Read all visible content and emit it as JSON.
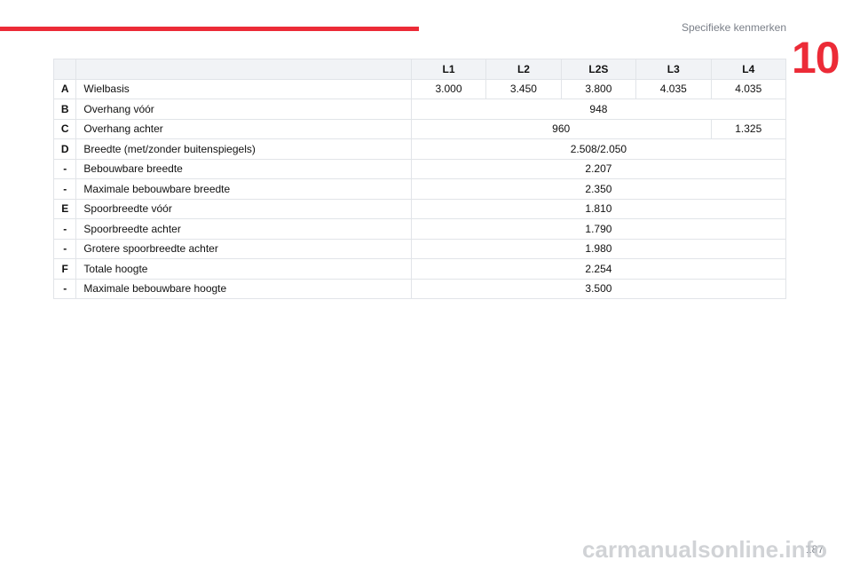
{
  "header": {
    "section_title": "Specifieke kenmerken",
    "chapter_number": "10",
    "accent_color": "#ec2b37"
  },
  "table": {
    "columns": [
      "L1",
      "L2",
      "L2S",
      "L3",
      "L4"
    ],
    "rows": [
      {
        "letter": "A",
        "label": "Wielbasis",
        "values": [
          {
            "text": "3.000",
            "span": 1
          },
          {
            "text": "3.450",
            "span": 1
          },
          {
            "text": "3.800",
            "span": 1
          },
          {
            "text": "4.035",
            "span": 1
          },
          {
            "text": "4.035",
            "span": 1
          }
        ]
      },
      {
        "letter": "B",
        "label": "Overhang vóór",
        "values": [
          {
            "text": "948",
            "span": 5
          }
        ]
      },
      {
        "letter": "C",
        "label": "Overhang achter",
        "values": [
          {
            "text": "960",
            "span": 4
          },
          {
            "text": "1.325",
            "span": 1
          }
        ]
      },
      {
        "letter": "D",
        "label": "Breedte (met/zonder buitenspiegels)",
        "values": [
          {
            "text": "2.508/2.050",
            "span": 5
          }
        ]
      },
      {
        "letter": "-",
        "label": "Bebouwbare breedte",
        "values": [
          {
            "text": "2.207",
            "span": 5
          }
        ]
      },
      {
        "letter": "-",
        "label": "Maximale bebouwbare breedte",
        "values": [
          {
            "text": "2.350",
            "span": 5
          }
        ]
      },
      {
        "letter": "E",
        "label": "Spoorbreedte vóór",
        "values": [
          {
            "text": "1.810",
            "span": 5
          }
        ]
      },
      {
        "letter": "-",
        "label": "Spoorbreedte achter",
        "values": [
          {
            "text": "1.790",
            "span": 5
          }
        ]
      },
      {
        "letter": "-",
        "label": "Grotere spoorbreedte achter",
        "values": [
          {
            "text": "1.980",
            "span": 5
          }
        ]
      },
      {
        "letter": "F",
        "label": "Totale hoogte",
        "values": [
          {
            "text": "2.254",
            "span": 5
          }
        ]
      },
      {
        "letter": "-",
        "label": "Maximale bebouwbare hoogte",
        "values": [
          {
            "text": "3.500",
            "span": 5
          }
        ]
      }
    ]
  },
  "footer": {
    "page_number": "187",
    "watermark": "carmanualsonline.info"
  }
}
